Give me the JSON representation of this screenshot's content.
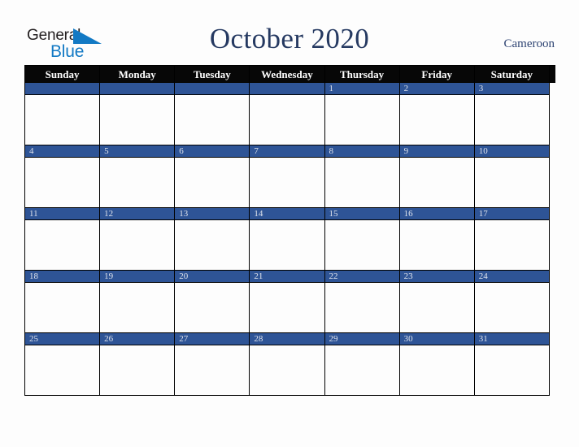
{
  "brand": {
    "word_one": "General",
    "word_two": "Blue",
    "triangle_icon": "blue-triangle-icon",
    "color_dark": "#231f20",
    "color_blue": "#1279c4"
  },
  "header": {
    "title": "October 2020",
    "country": "Cameroon",
    "title_color": "#253961",
    "country_color": "#2d4372"
  },
  "calendar": {
    "month": "October",
    "year": "2020",
    "weekday_headers": [
      "Sunday",
      "Monday",
      "Tuesday",
      "Wednesday",
      "Thursday",
      "Friday",
      "Saturday"
    ],
    "header_bg": "#070707",
    "header_text_color": "#ffffff",
    "date_bar_bg": "#2e5496",
    "date_text_color": "#dfe3ec",
    "cell_bg": "#fdfdfd",
    "border_color": "#000000",
    "weeks": [
      [
        {
          "date": "",
          "empty": true
        },
        {
          "date": "",
          "empty": true
        },
        {
          "date": "",
          "empty": true
        },
        {
          "date": "",
          "empty": true
        },
        {
          "date": "1",
          "empty": false
        },
        {
          "date": "2",
          "empty": false
        },
        {
          "date": "3",
          "empty": false
        }
      ],
      [
        {
          "date": "4",
          "empty": false
        },
        {
          "date": "5",
          "empty": false
        },
        {
          "date": "6",
          "empty": false
        },
        {
          "date": "7",
          "empty": false
        },
        {
          "date": "8",
          "empty": false
        },
        {
          "date": "9",
          "empty": false
        },
        {
          "date": "10",
          "empty": false
        }
      ],
      [
        {
          "date": "11",
          "empty": false
        },
        {
          "date": "12",
          "empty": false
        },
        {
          "date": "13",
          "empty": false
        },
        {
          "date": "14",
          "empty": false
        },
        {
          "date": "15",
          "empty": false
        },
        {
          "date": "16",
          "empty": false
        },
        {
          "date": "17",
          "empty": false
        }
      ],
      [
        {
          "date": "18",
          "empty": false
        },
        {
          "date": "19",
          "empty": false
        },
        {
          "date": "20",
          "empty": false
        },
        {
          "date": "21",
          "empty": false
        },
        {
          "date": "22",
          "empty": false
        },
        {
          "date": "23",
          "empty": false
        },
        {
          "date": "24",
          "empty": false
        }
      ],
      [
        {
          "date": "25",
          "empty": false
        },
        {
          "date": "26",
          "empty": false
        },
        {
          "date": "27",
          "empty": false
        },
        {
          "date": "28",
          "empty": false
        },
        {
          "date": "29",
          "empty": false
        },
        {
          "date": "30",
          "empty": false
        },
        {
          "date": "31",
          "empty": false
        }
      ]
    ]
  }
}
